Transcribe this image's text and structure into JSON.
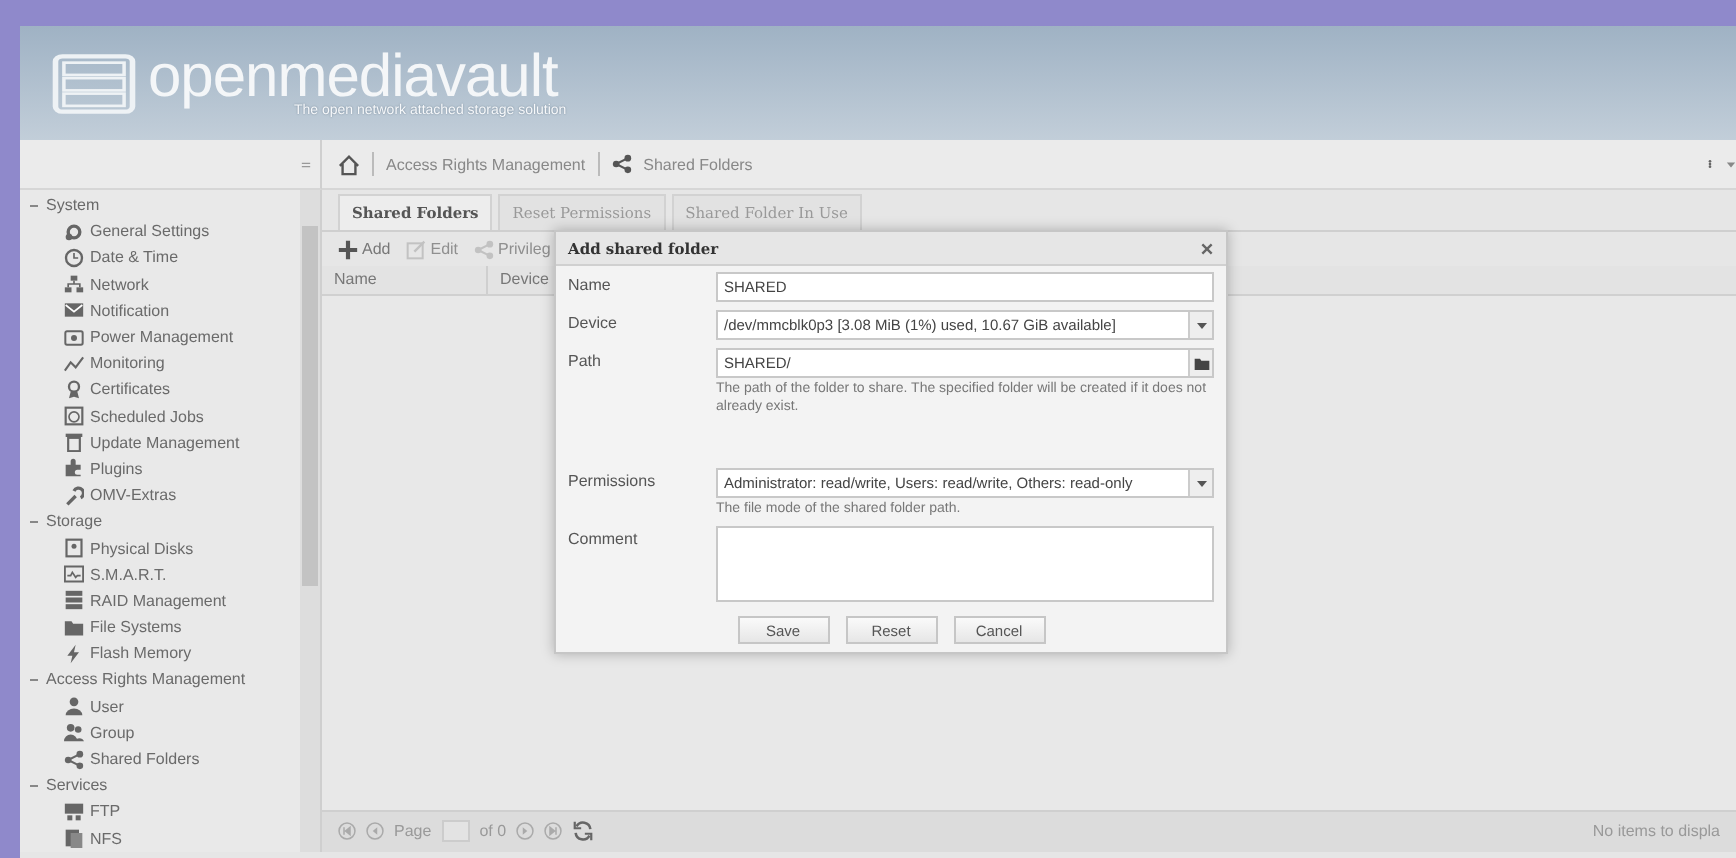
{
  "header": {
    "logo_text": "openmediavault",
    "tagline": "The open network attached storage solution"
  },
  "sidebar": {
    "groups": [
      {
        "label": "System",
        "expanded": true,
        "children": [
          {
            "label": "General Settings"
          },
          {
            "label": "Date & Time"
          },
          {
            "label": "Network"
          },
          {
            "label": "Notification"
          },
          {
            "label": "Power Management"
          },
          {
            "label": "Monitoring"
          },
          {
            "label": "Certificates"
          },
          {
            "label": "Scheduled Jobs"
          },
          {
            "label": "Update Management"
          },
          {
            "label": "Plugins"
          },
          {
            "label": "OMV-Extras"
          }
        ]
      },
      {
        "label": "Storage",
        "expanded": true,
        "children": [
          {
            "label": "Physical Disks"
          },
          {
            "label": "S.M.A.R.T."
          },
          {
            "label": "RAID Management"
          },
          {
            "label": "File Systems"
          },
          {
            "label": "Flash Memory"
          }
        ]
      },
      {
        "label": "Access Rights Management",
        "expanded": true,
        "children": [
          {
            "label": "User"
          },
          {
            "label": "Group"
          },
          {
            "label": "Shared Folders"
          }
        ]
      },
      {
        "label": "Services",
        "expanded": true,
        "children": [
          {
            "label": "FTP"
          },
          {
            "label": "NFS"
          }
        ]
      }
    ]
  },
  "breadcrumb": [
    "Access Rights Management",
    "Shared Folders"
  ],
  "tabs": [
    {
      "label": "Shared Folders",
      "selected": true
    },
    {
      "label": "Reset Permissions",
      "selected": false
    },
    {
      "label": "Shared Folder In Use",
      "selected": false
    }
  ],
  "toolbar": [
    {
      "label": "Add",
      "disabled": false
    },
    {
      "label": "Edit",
      "disabled": true
    },
    {
      "label": "Privileg",
      "disabled": true
    }
  ],
  "table": {
    "columns": [
      "Name",
      "Device"
    ]
  },
  "dialog": {
    "title": "Add shared folder",
    "fields": [
      {
        "kind": "text",
        "label": "Name",
        "value": "SHARED"
      },
      {
        "kind": "select",
        "label": "Device",
        "value": "/dev/mmcblk0p3 [3.08 MiB (1%) used, 10.67 GiB available]"
      },
      {
        "kind": "path",
        "label": "Path",
        "value": "SHARED/",
        "help": "The path of the folder to share. The specified folder will be created if it does not already exist."
      },
      {
        "kind": "select",
        "label": "Permissions",
        "value": "Administrator: read/write, Users: read/write, Others: read-only",
        "help": "The file mode of the shared folder path."
      },
      {
        "kind": "textarea",
        "label": "Comment"
      }
    ],
    "buttons": [
      "Save",
      "Reset",
      "Cancel"
    ]
  },
  "paging": {
    "page_label": "Page",
    "of_label": "of 0",
    "status": "No items to displa"
  }
}
